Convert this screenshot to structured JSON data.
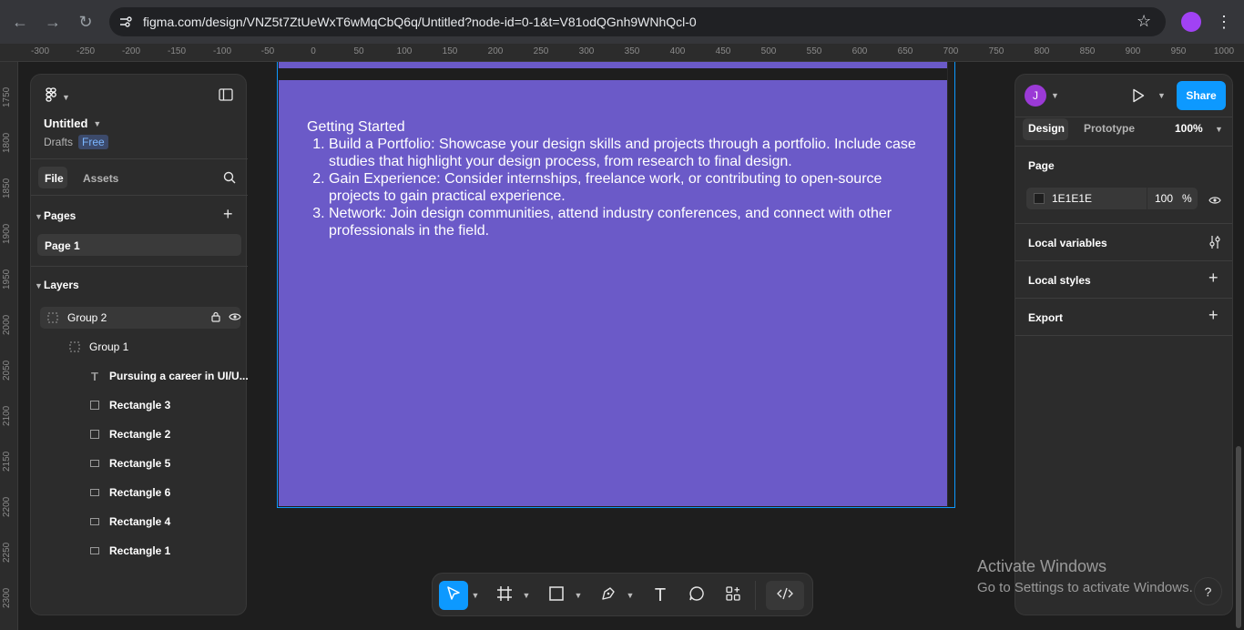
{
  "browser": {
    "url": "figma.com/design/VNZ5t7ZtUeWxT6wMqCbQ6q/Untitled?node-id=0-1&t=V81odQGnh9WNhQcl-0"
  },
  "rulers": {
    "top": [
      "-300",
      "-250",
      "-200",
      "-150",
      "-100",
      "-50",
      "0",
      "50",
      "100",
      "150",
      "200",
      "250",
      "300",
      "350",
      "400",
      "450",
      "500",
      "550",
      "600",
      "650",
      "700",
      "750",
      "800",
      "850",
      "900",
      "950",
      "1000"
    ],
    "left": [
      "1750",
      "1800",
      "1850",
      "1900",
      "1950",
      "2000",
      "2050",
      "2100",
      "2150",
      "2200",
      "2250",
      "2300"
    ]
  },
  "frame": {
    "heading": "Getting Started",
    "items": [
      "Build a Portfolio: Showcase your design skills and projects through a portfolio. Include case studies that highlight your design process, from research to final design.",
      "Gain Experience: Consider internships, freelance work, or contributing to open-source projects to gain practical experience.",
      "Network: Join design communities, attend industry conferences, and connect with other professionals in the field."
    ]
  },
  "left_panel": {
    "file_name": "Untitled",
    "location": "Drafts",
    "plan_badge": "Free",
    "tabs": [
      "File",
      "Assets"
    ],
    "pages_header": "Pages",
    "pages": [
      "Page 1"
    ],
    "layers_header": "Layers",
    "layers": [
      {
        "name": "Group 2",
        "icon": "group-icon"
      },
      {
        "name": "Group 1",
        "icon": "group-icon"
      },
      {
        "name": "Pursuing a career in UI/U...",
        "icon": "text-icon"
      },
      {
        "name": "Rectangle 3",
        "icon": "rectangle-icon"
      },
      {
        "name": "Rectangle 2",
        "icon": "rectangle-icon"
      },
      {
        "name": "Rectangle 5",
        "icon": "rectangle-icon"
      },
      {
        "name": "Rectangle 6",
        "icon": "rectangle-icon"
      },
      {
        "name": "Rectangle 4",
        "icon": "rectangle-icon"
      },
      {
        "name": "Rectangle 1",
        "icon": "rectangle-icon"
      }
    ]
  },
  "right_panel": {
    "avatar_initial": "J",
    "share_label": "Share",
    "tabs": [
      "Design",
      "Prototype"
    ],
    "zoom": "100%",
    "page_section": "Page",
    "page_color": "1E1E1E",
    "page_opacity": "100",
    "percent_sign": "%",
    "sections": [
      "Local variables",
      "Local styles",
      "Export"
    ]
  },
  "watermark": {
    "title": "Activate Windows",
    "subtitle": "Go to Settings to activate Windows."
  },
  "help_label": "?",
  "colors": {
    "frame_fill": "#6b5ac8",
    "accent": "#0d99ff",
    "panel": "#2c2c2c"
  }
}
